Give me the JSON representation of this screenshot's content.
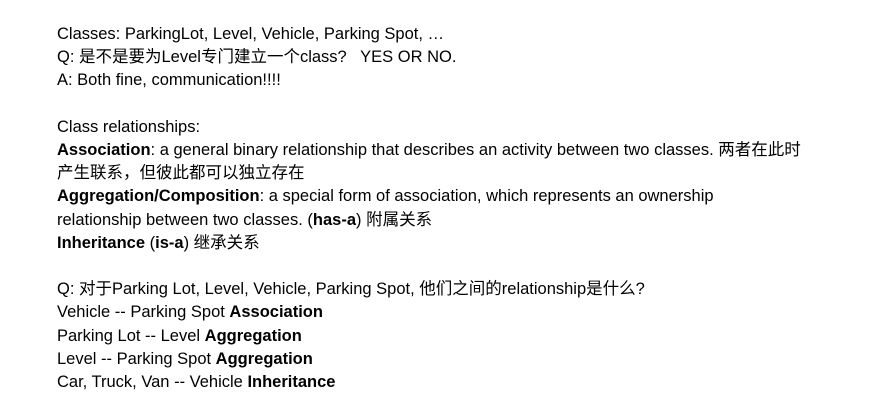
{
  "classes_line": "Classes: ParkingLot, Level, Vehicle, Parking Spot, …",
  "q1": "Q: 是不是要为Level专门建立一个class?   YES OR NO.",
  "a1": "A: Both fine, communication!!!!",
  "rel_heading": "Class relationships:",
  "association": {
    "term": "Association",
    "desc": ": a general binary relationship that describes an activity between two classes. 两者在此时产生联系，但彼此都可以独立存在"
  },
  "aggregation": {
    "term": "Aggregation/Composition",
    "desc": ": a special form of association, which represents an ownership relationship between two classes. (",
    "has_a": "has-a",
    "tail": ") 附属关系"
  },
  "inheritance": {
    "term": "Inheritance",
    "open": " (",
    "is_a": "is-a",
    "tail": ") 继承关系"
  },
  "q2": "Q: 对于Parking Lot, Level, Vehicle, Parking Spot, 他们之间的relationship是什么?",
  "answers": [
    {
      "pair": "Vehicle -- Parking Spot ",
      "type": "Association"
    },
    {
      "pair": "Parking Lot -- Level ",
      "type": "Aggregation"
    },
    {
      "pair": "Level -- Parking Spot ",
      "type": "Aggregation"
    },
    {
      "pair": "Car, Truck, Van -- Vehicle ",
      "type": "Inheritance"
    }
  ]
}
